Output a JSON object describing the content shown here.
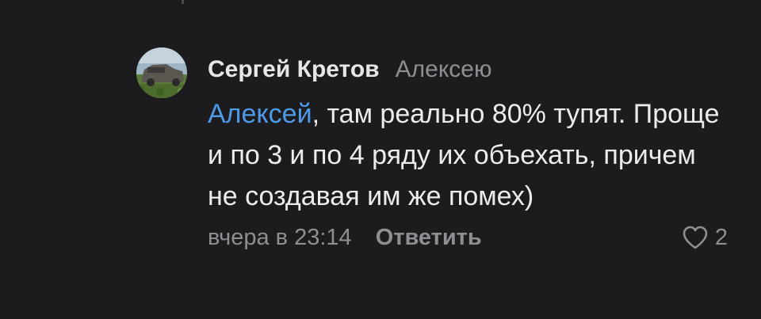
{
  "comment": {
    "author": "Сергей Кретов",
    "reply_to": "Алексею",
    "mention": "Алексей",
    "text": ", там реально 80% тупят. Проще и по 3 и по 4 ряду их объехать, причем не создавая им же помех)",
    "time": "вчера в 23:14",
    "reply_label": "Ответить",
    "likes": "2"
  },
  "icons": {
    "like": "heart-outline-icon"
  },
  "colors": {
    "background": "#1c1b1d",
    "mention": "#4d9be8",
    "secondary_text": "#8e8e93",
    "primary_text": "#ececee"
  }
}
